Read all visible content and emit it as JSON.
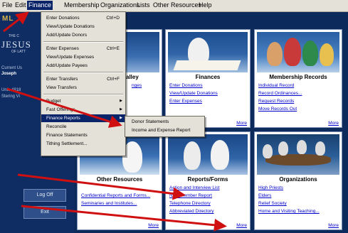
{
  "menubar": {
    "file": "File",
    "edit": "Edit",
    "finance": "Finance",
    "membership": "Membership",
    "organizations": "Organizations",
    "lists": "Lists",
    "other": "Other Resources",
    "help": "Help"
  },
  "sidebar": {
    "brand": "ML",
    "church_the": "THE C",
    "church_jesus": "JESUS",
    "church_latter": "OF LATT",
    "current_user": "Current Us",
    "user": "Joseph",
    "unit": "Unit: 4818",
    "stake": "Stering Vi",
    "logoff": "Log Off",
    "exit": "Exit"
  },
  "partial": {
    "valley": "alley",
    "changes": "nges"
  },
  "panels": {
    "finances": {
      "title": "Finances",
      "links": [
        "Enter Donations",
        "View/Update Donations",
        "Enter Expenses"
      ],
      "more": "More"
    },
    "membership": {
      "title": "Membership Records",
      "links": [
        "Individual Record",
        "Record Ordinances...",
        "Request Records",
        "Move Records Out"
      ],
      "more": "More"
    },
    "other": {
      "title": "Other Resources",
      "links": [
        "Confidential Reports and Forms...",
        "Seminaries and Institutes..."
      ],
      "more": "More"
    },
    "reports": {
      "title": "Reports/Forms",
      "links": [
        "Action and Interview List",
        "New Member Report",
        "Telephone Directory",
        "Abbreviated Directory"
      ],
      "more": "More"
    },
    "organizations": {
      "title": "Organizations",
      "links": [
        "High Priests",
        "Elders",
        "Relief Society",
        "Home and Visiting Teaching..."
      ],
      "more": "More"
    }
  },
  "finance_menu": {
    "items": [
      {
        "label": "Enter Donations",
        "key": "Ctrl+D"
      },
      {
        "label": "View/Update Donations",
        "key": ""
      },
      {
        "label": "Add/Update Donors",
        "key": ""
      },
      {
        "label": "Enter Expenses",
        "key": "Ctrl+E"
      },
      {
        "label": "View/Update Expenses",
        "key": ""
      },
      {
        "label": "Add/Update Payees",
        "key": ""
      },
      {
        "label": "Enter Transfers",
        "key": "Ctrl+F"
      },
      {
        "label": "View Transfers",
        "key": ""
      },
      {
        "label": "Budget",
        "key": ""
      },
      {
        "label": "Fast Offerings",
        "key": ""
      },
      {
        "label": "Finance Reports",
        "key": ""
      },
      {
        "label": "Reconcile",
        "key": ""
      },
      {
        "label": "Finance Statements",
        "key": ""
      },
      {
        "label": "Tithing Settlement...",
        "key": ""
      }
    ]
  },
  "reports_submenu": {
    "items": [
      "Donor Statements",
      "Income and Expense Report"
    ]
  },
  "colors": {
    "menu_highlight": "#0a246a",
    "arrow": "#d01010",
    "link": "#0000cc",
    "background": "#0d2a5c"
  }
}
